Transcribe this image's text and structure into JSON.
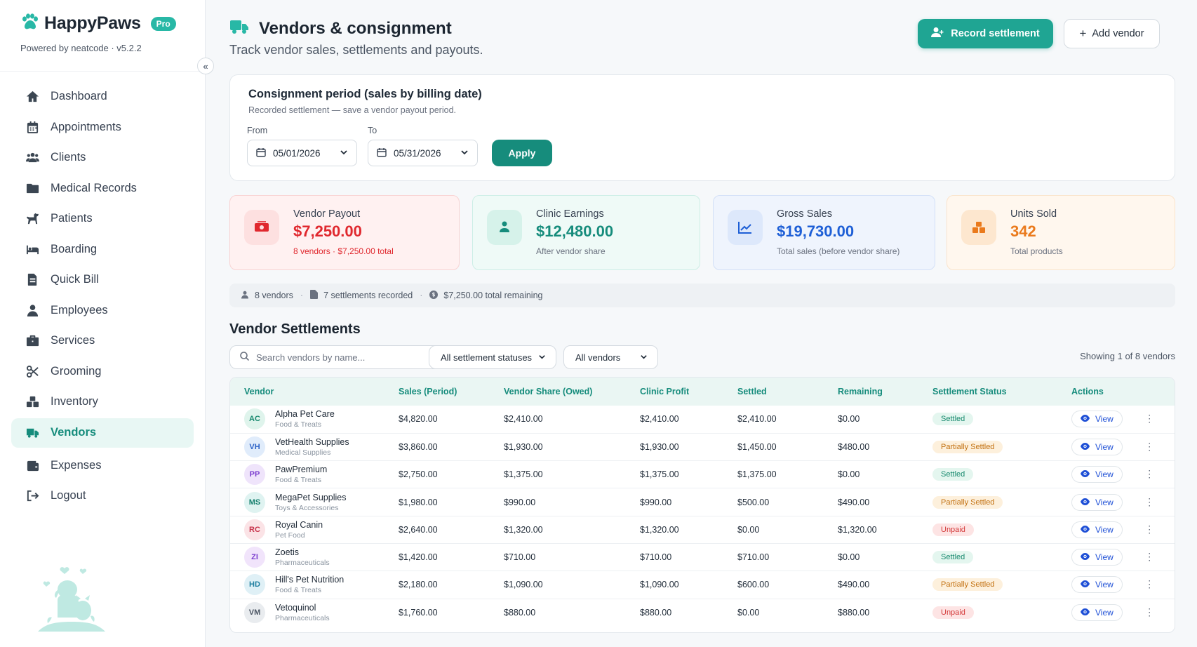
{
  "brand": {
    "name": "HappyPaws",
    "badge": "Pro",
    "subtitle": "Powered by neatcode · v5.2.2"
  },
  "sidebar": {
    "collapse_icon": "«",
    "items": [
      {
        "label": "Dashboard",
        "icon": "home-icon"
      },
      {
        "label": "Appointments",
        "icon": "calendar-icon"
      },
      {
        "label": "Clients",
        "icon": "users-icon"
      },
      {
        "label": "Medical Records",
        "icon": "folder-icon"
      },
      {
        "label": "Patients",
        "icon": "dog-icon"
      },
      {
        "label": "Boarding",
        "icon": "bed-icon"
      },
      {
        "label": "Quick Bill",
        "icon": "file-invoice-icon"
      },
      {
        "label": "Employees",
        "icon": "user-icon"
      },
      {
        "label": "Services",
        "icon": "briefcase-icon"
      },
      {
        "label": "Grooming",
        "icon": "scissors-icon"
      },
      {
        "label": "Inventory",
        "icon": "boxes-icon"
      },
      {
        "label": "Vendors",
        "icon": "truck-icon",
        "active": true
      },
      {
        "label": "Expenses",
        "icon": "wallet-icon"
      },
      {
        "label": "Logout",
        "icon": "logout-icon"
      }
    ]
  },
  "header": {
    "title": "Vendors & consignment",
    "subtitle": "Track vendor sales, settlements and payouts.",
    "record_button": "Record settlement",
    "add_button": "Add vendor",
    "add_plus": "+"
  },
  "period": {
    "title": "Consignment period (sales by billing date)",
    "note": "Recorded settlement — save a vendor payout period.",
    "from_label": "From",
    "from_value": "05/01/2026",
    "to_label": "To",
    "to_value": "05/31/2026",
    "apply_label": "Apply"
  },
  "stats": [
    {
      "label": "Vendor Payout",
      "value": "$7,250.00",
      "note": "8 vendors · $7,250.00 total",
      "icon": "money-icon",
      "color": "#e0282e"
    },
    {
      "label": "Clinic Earnings",
      "value": "$12,480.00",
      "note": "After vendor share",
      "icon": "hand-user-icon",
      "color": "#168c7c"
    },
    {
      "label": "Gross Sales",
      "value": "$19,730.00",
      "note": "Total sales (before vendor share)",
      "icon": "chart-line-icon",
      "color": "#1e5fd6"
    },
    {
      "label": "Units Sold",
      "value": "342",
      "note": "Total products",
      "icon": "boxes-icon",
      "color": "#ea7a1c"
    }
  ],
  "summary": {
    "vendors": "8 vendors",
    "settlements": "7 settlements recorded",
    "remaining": "$7,250.00 total remaining",
    "sep": "·"
  },
  "settlements": {
    "title": "Vendor Settlements",
    "search_placeholder": "Search vendors by name...",
    "status_filter": "All settlement statuses",
    "vendor_filter": "All vendors",
    "showing": "Showing 1 of 8 vendors",
    "view_label": "View",
    "more_label": "⋮",
    "columns": [
      "Vendor",
      "Sales (Period)",
      "Vendor Share (Owed)",
      "Clinic Profit",
      "Settled",
      "Remaining",
      "Settlement Status",
      "Actions"
    ],
    "rows": [
      {
        "initials": "AC",
        "name": "Alpha Pet Care",
        "category": "Food & Treats",
        "sales": "$4,820.00",
        "share": "$2,410.00",
        "profit": "$2,410.00",
        "settled": "$2,410.00",
        "remaining": "$0.00",
        "status": "Settled",
        "status_kind": "settled",
        "avatar_bg": "#dff4ec",
        "avatar_fg": "#17896e"
      },
      {
        "initials": "VH",
        "name": "VetHealth Supplies",
        "category": "Medical Supplies",
        "sales": "$3,860.00",
        "share": "$1,930.00",
        "profit": "$1,930.00",
        "settled": "$1,450.00",
        "remaining": "$480.00",
        "status": "Partially Settled",
        "status_kind": "partial",
        "avatar_bg": "#e0ecfb",
        "avatar_fg": "#2e64c8"
      },
      {
        "initials": "PP",
        "name": "PawPremium",
        "category": "Food & Treats",
        "sales": "$2,750.00",
        "share": "$1,375.00",
        "profit": "$1,375.00",
        "settled": "$1,375.00",
        "remaining": "$0.00",
        "status": "Settled",
        "status_kind": "settled",
        "avatar_bg": "#efe4fb",
        "avatar_fg": "#7c3fcf"
      },
      {
        "initials": "MS",
        "name": "MegaPet Supplies",
        "category": "Toys & Accessories",
        "sales": "$1,980.00",
        "share": "$990.00",
        "profit": "$990.00",
        "settled": "$500.00",
        "remaining": "$490.00",
        "status": "Partially Settled",
        "status_kind": "partial",
        "avatar_bg": "#dff3f1",
        "avatar_fg": "#17806f"
      },
      {
        "initials": "RC",
        "name": "Royal Canin",
        "category": "Pet Food",
        "sales": "$2,640.00",
        "share": "$1,320.00",
        "profit": "$1,320.00",
        "settled": "$0.00",
        "remaining": "$1,320.00",
        "status": "Unpaid",
        "status_kind": "unpaid",
        "avatar_bg": "#fbe3e6",
        "avatar_fg": "#c8324a"
      },
      {
        "initials": "ZI",
        "name": "Zoetis",
        "category": "Pharmaceuticals",
        "sales": "$1,420.00",
        "share": "$710.00",
        "profit": "$710.00",
        "settled": "$710.00",
        "remaining": "$0.00",
        "status": "Settled",
        "status_kind": "settled",
        "avatar_bg": "#f1e4fb",
        "avatar_fg": "#7c3fcf"
      },
      {
        "initials": "HD",
        "name": "Hill's Pet Nutrition",
        "category": "Food & Treats",
        "sales": "$2,180.00",
        "share": "$1,090.00",
        "profit": "$1,090.00",
        "settled": "$600.00",
        "remaining": "$490.00",
        "status": "Partially Settled",
        "status_kind": "partial",
        "avatar_bg": "#dff0f6",
        "avatar_fg": "#1f7fa0"
      },
      {
        "initials": "VM",
        "name": "Vetoquinol",
        "category": "Pharmaceuticals",
        "sales": "$1,760.00",
        "share": "$880.00",
        "profit": "$880.00",
        "settled": "$0.00",
        "remaining": "$880.00",
        "status": "Unpaid",
        "status_kind": "unpaid",
        "avatar_bg": "#e9ecef",
        "avatar_fg": "#4b5563"
      }
    ]
  }
}
